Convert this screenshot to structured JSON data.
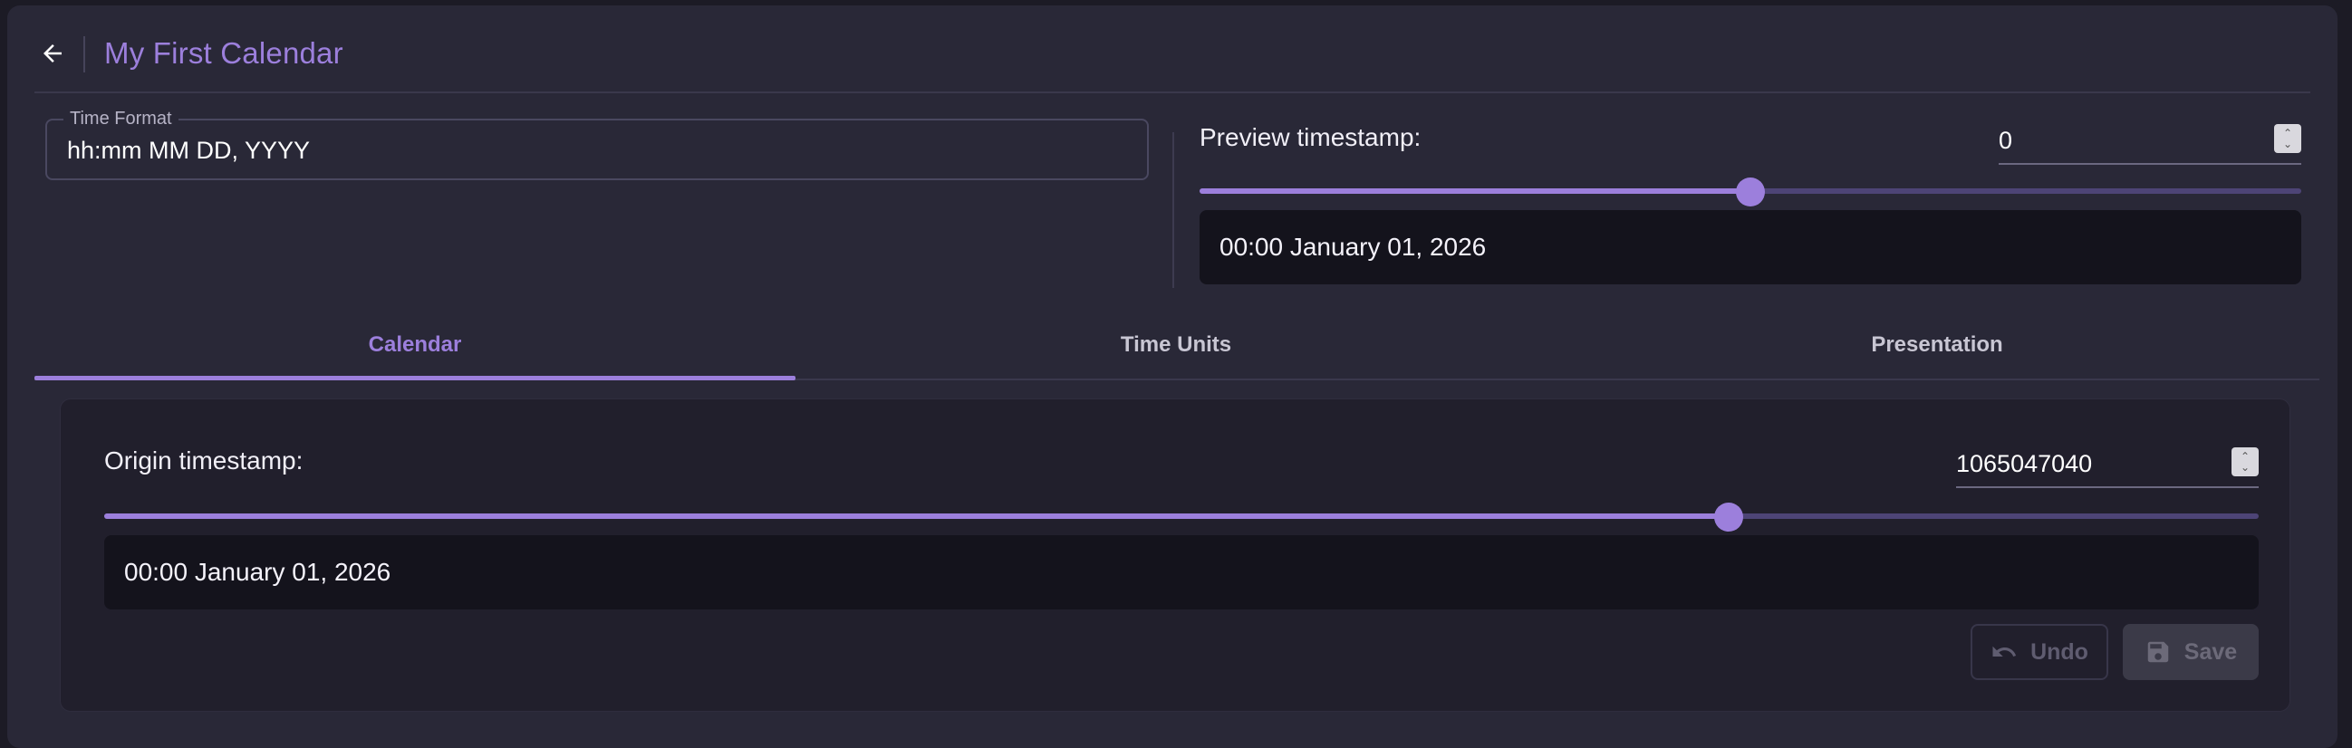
{
  "header": {
    "back_icon": "arrow-left-icon",
    "title": "My First Calendar"
  },
  "time_format": {
    "label": "Time Format",
    "value": "hh:mm MM DD, YYYY"
  },
  "preview": {
    "label": "Preview timestamp:",
    "value": "0",
    "slider_fraction": 0.5,
    "output": "00:00 January 01, 2026"
  },
  "tabs": [
    {
      "label": "Calendar",
      "active": true
    },
    {
      "label": "Time Units",
      "active": false
    },
    {
      "label": "Presentation",
      "active": false
    }
  ],
  "calendar_panel": {
    "origin_label": "Origin timestamp:",
    "origin_value": "1065047040",
    "slider_fraction": 0.754,
    "output": "00:00 January 01, 2026",
    "undo_label": "Undo",
    "undo_icon": "undo-icon",
    "save_label": "Save",
    "save_icon": "floppy-disk-icon"
  },
  "colors": {
    "accent": "#9c7fdc",
    "background": "#292837",
    "output_box": "#14131c"
  }
}
